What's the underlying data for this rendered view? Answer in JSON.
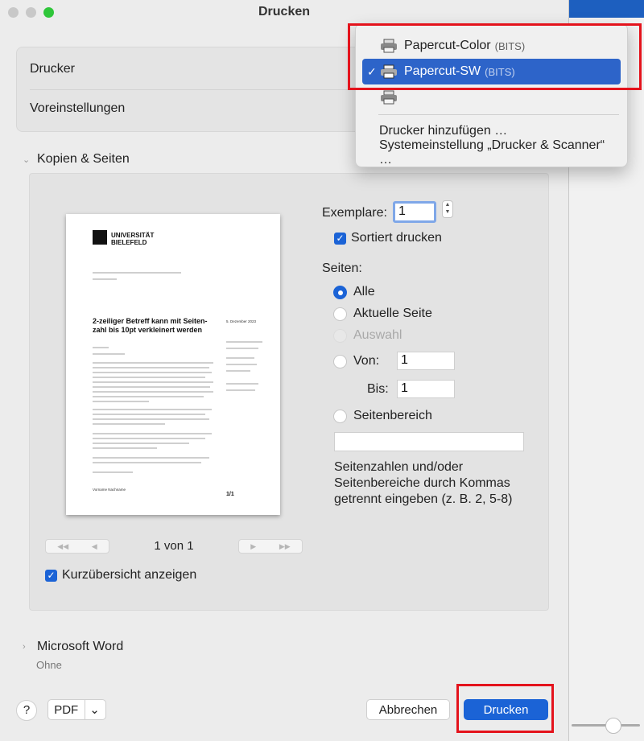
{
  "window": {
    "title": "Drucken"
  },
  "settings": {
    "printer_label": "Drucker",
    "presets_label": "Voreinstellungen"
  },
  "printer_menu": {
    "items": [
      {
        "name": "Papercut-Color",
        "suffix": "(BITS)"
      },
      {
        "name": "Papercut-SW",
        "suffix": "(BITS)",
        "selected": true
      },
      {
        "name": "",
        "suffix": ""
      }
    ],
    "add_printer": "Drucker hinzufügen …",
    "system_settings": "Systemeinstellung „Drucker & Scanner“ …"
  },
  "copies_section": {
    "title": "Kopien & Seiten",
    "copies_label": "Exemplare:",
    "copies_value": "1",
    "collate_label": "Sortiert drucken",
    "pages_label": "Seiten:",
    "radio_all": "Alle",
    "radio_current": "Aktuelle Seite",
    "radio_selection": "Auswahl",
    "radio_from": "Von:",
    "from_value": "1",
    "to_label": "Bis:",
    "to_value": "1",
    "radio_range": "Seitenbereich",
    "range_value": "",
    "hint": "Seitenzahlen und/oder Seitenbereiche durch Kommas getrennt eingeben (z. B. 2, 5-8)",
    "page_counter": "1 von 1",
    "thumbnails_label": "Kurzübersicht anzeigen"
  },
  "preview": {
    "logo": "UNIVERSITÄT\nBIELEFELD",
    "heading": "2-zeiliger Betreff kann mit Seiten-zahl bis 10pt verkleinert werden",
    "date": "5. Dezember 2023",
    "page_number": "1/1",
    "signature": "Vorname Nachname"
  },
  "word_section": {
    "title": "Microsoft Word",
    "subtitle": "Ohne"
  },
  "footer": {
    "help": "?",
    "pdf": "PDF",
    "cancel": "Abbrechen",
    "print": "Drucken"
  }
}
